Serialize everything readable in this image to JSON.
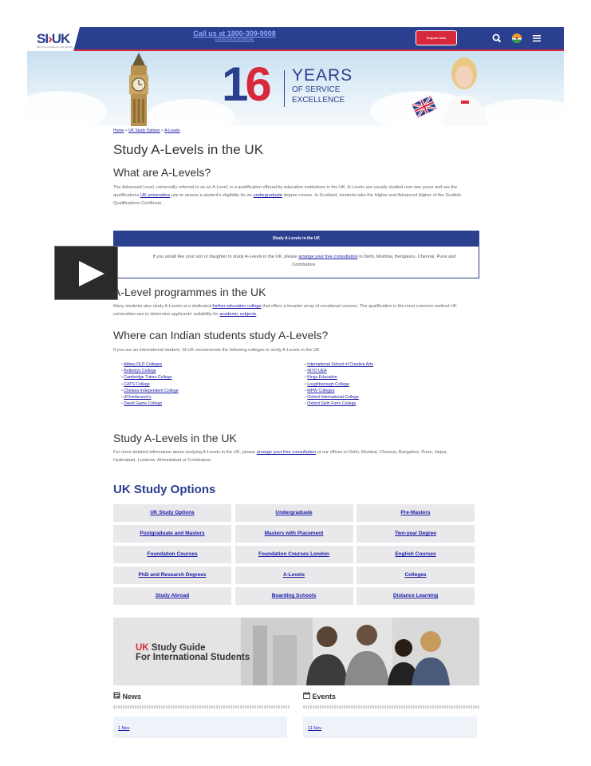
{
  "header": {
    "logo_text": "SI-UK",
    "logo_tagline": "BRITISH COUNSELLING FOR INDIANS",
    "call_text": "Call us at 1800-309-9008",
    "call_subtext": "10:00 am to 8:00 pm (Mon-Sat)",
    "enquire_label": "Enquire Now",
    "icons": [
      "search-icon",
      "india-flag-icon",
      "menu-icon"
    ]
  },
  "banner": {
    "number": "16",
    "years": "YEARS",
    "line1": "OF SERVICE",
    "line2": "EXCELLENCE"
  },
  "breadcrumb": {
    "home": "Home",
    "sep": " > ",
    "uk_study_options": "UK Study Options",
    "current": "A-Levels"
  },
  "page_title": "Study A-Levels in the UK",
  "what_are": {
    "heading": "What are A-Levels?",
    "p1": "The Advanced Level, universally referred to as an A-Level, is a qualification offered by education institutions in the UK. A-Levels are usually studied over two years and are the qualifications ",
    "link1": "UK universities",
    "p2": " use to assess a student's eligibility for an ",
    "link2": "undergraduate",
    "p3": " degree course. In Scotland, students take the Higher and Advanced Higher of the Scottish Qualifications Certificate."
  },
  "infobox": {
    "heading": "Study A-Levels in the UK",
    "t1": "If you would like your son or daughter to study A-Levels in the UK, please ",
    "link": "arrange your free consultation",
    "t2": " in Delhi, Mumbai, Bengaluru, Chennai, Pune and Coimbatore."
  },
  "programmes": {
    "heading": "A-Level programmes in the UK",
    "t1": "Many students also study A-Levels at a dedicated ",
    "link1": "further education college",
    "t2": " that offers a broader array of vocational courses. The qualification is the most common method UK universities use to determine applicants' suitability for ",
    "link2": "academic subjects",
    "t3": "."
  },
  "where": {
    "heading": "Where can Indian students study A-Levels?",
    "intro": "If you are an international student, SI-UK recommends the following colleges to study A-Levels in the UK.",
    "col1": [
      "Abbey DLD Colleges",
      "Bellerbys College",
      "Cambridge Tutors College",
      "CATS College",
      "Chelsea Independent College",
      "d'Overbroeck's",
      "David Game College"
    ],
    "col2": [
      "International School of Creative Arts",
      "INTO UEA",
      "Kings Education",
      "Loughborough College",
      "MPW Colleges",
      "Oxford International College",
      "Oxford Sixth Form College"
    ]
  },
  "study_section": {
    "heading": "Study A-Levels in the UK",
    "t1": "For more detailed information about studying A-Levels in the UK, please ",
    "link": "arrange your free consultation",
    "t2": " at our offices in Delhi, Mumbai, Chennai, Bangalore, Pune, Jaipur, Hyderabad, Lucknow, Ahmedabad or Coimbatore."
  },
  "options": {
    "heading": "UK Study Options",
    "items": [
      "UK Study Options",
      "Undergraduate",
      "Pre-Masters",
      "Postgraduate and Masters",
      "Masters with Placement",
      "Two-year Degree",
      "Foundation Courses",
      "Foundation Courses London",
      "English Courses",
      "PhD and Research Degrees",
      "A-Levels",
      "Colleges",
      "Study Abroad",
      "Boarding Schools",
      "Distance Learning"
    ]
  },
  "guide": {
    "uk": "UK",
    "rest1": " Study Guide",
    "line2": "For International Students"
  },
  "news": {
    "heading": "News",
    "item": "1 Nov"
  },
  "events": {
    "heading": "Events",
    "item": "11 Nov"
  },
  "colors": {
    "navy": "#2b3f8f",
    "red": "#d7283c",
    "link": "#1a1aa6"
  }
}
